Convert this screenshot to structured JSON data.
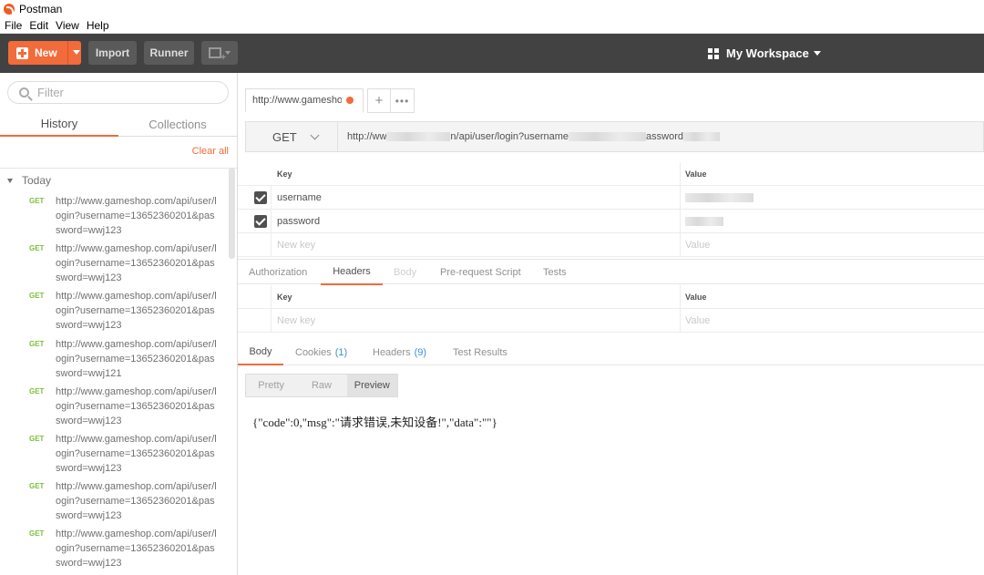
{
  "window": {
    "title": "Postman"
  },
  "menu": [
    "File",
    "Edit",
    "View",
    "Help"
  ],
  "toolbar": {
    "new_label": "New",
    "import_label": "Import",
    "runner_label": "Runner",
    "workspace_label": "My Workspace"
  },
  "sidebar": {
    "filter_placeholder": "Filter",
    "tabs": [
      "History",
      "Collections"
    ],
    "clear_all": "Clear all",
    "group_label": "Today",
    "history": [
      {
        "method": "GET",
        "url": "http://www.gameshop.com/api/user/login?username=13652360201&password=wwj123"
      },
      {
        "method": "GET",
        "url": "http://www.gameshop.com/api/user/login?username=13652360201&password=wwj123"
      },
      {
        "method": "GET",
        "url": "http://www.gameshop.com/api/user/login?username=13652360201&password=wwj123"
      },
      {
        "method": "GET",
        "url": "http://www.gameshop.com/api/user/login?username=13652360201&password=wwj121"
      },
      {
        "method": "GET",
        "url": "http://www.gameshop.com/api/user/login?username=13652360201&password=wwj123"
      },
      {
        "method": "GET",
        "url": "http://www.gameshop.com/api/user/login?username=13652360201&password=wwj123"
      },
      {
        "method": "GET",
        "url": "http://www.gameshop.com/api/user/login?username=13652360201&password=wwj123"
      },
      {
        "method": "GET",
        "url": "http://www.gameshop.com/api/user/login?username=13652360201&password=wwj123"
      }
    ]
  },
  "request": {
    "tab_title": "http://www.gameshop.com/api/user/login",
    "tab_add": "+",
    "tab_more": "•••",
    "method": "GET",
    "url_part1": "http://ww",
    "url_part2": "n/api/user/login?username",
    "url_part3": "assword",
    "params": {
      "key_header": "Key",
      "value_header": "Value",
      "rows": [
        {
          "key": "username"
        },
        {
          "key": "password"
        }
      ],
      "new_key_placeholder": "New key",
      "new_value_placeholder": "Value"
    },
    "subtabs": [
      "Authorization",
      "Headers",
      "Body",
      "Pre-request Script",
      "Tests"
    ],
    "headers": {
      "key_header": "Key",
      "value_header": "Value",
      "new_key_placeholder": "New key",
      "new_value_placeholder": "Value"
    }
  },
  "response": {
    "tabs": {
      "body": "Body",
      "cookies": "Cookies",
      "cookies_count": "(1)",
      "headers": "Headers",
      "headers_count": "(9)",
      "test_results": "Test Results"
    },
    "view_modes": [
      "Pretty",
      "Raw",
      "Preview"
    ],
    "body_text": "{\"code\":0,\"msg\":\"请求错误,未知设备!\",\"data\":\"\"}"
  },
  "colors": {
    "accent": "#f26b3a",
    "toolbar_bg": "#424242",
    "get_method": "#7cbf3c",
    "count": "#3b8fd9"
  }
}
